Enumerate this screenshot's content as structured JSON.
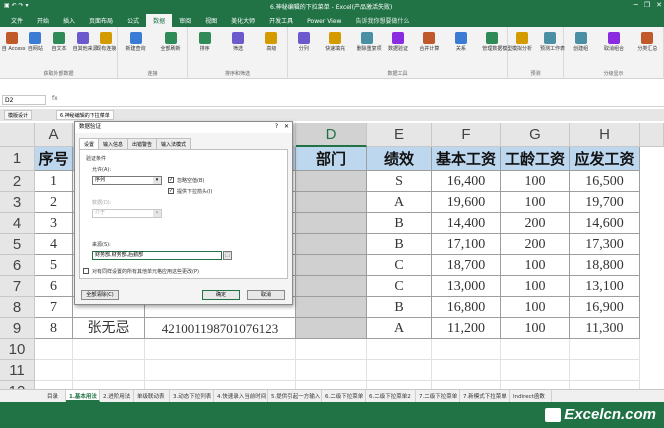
{
  "window": {
    "title": "6.神秘编辑的下拉菜单 - Excel(产品激活失败)",
    "quick_access": "▣ ↶ ↷ ▾"
  },
  "ribbon_tabs": [
    "文件",
    "开始",
    "插入",
    "页面布局",
    "公式",
    "数据",
    "审阅",
    "视图",
    "美化大师",
    "开发工具",
    "Power View"
  ],
  "active_tab_index": 5,
  "tell_me": "告诉我你想要做什么",
  "ribbon_groups": [
    {
      "label": "获取外部数据",
      "buttons": [
        "自 Access",
        "自网站",
        "自文本",
        "自其他来源",
        "现有连接"
      ]
    },
    {
      "label": "连接",
      "buttons": [
        "新建查询",
        "全部刷新"
      ]
    },
    {
      "label": "排序和筛选",
      "buttons": [
        "排序",
        "筛选",
        "高级"
      ]
    },
    {
      "label": "数据工具",
      "buttons": [
        "分列",
        "快速填充",
        "删除重复项",
        "数据验证",
        "合并计算",
        "关系",
        "管理数据模型"
      ]
    },
    {
      "label": "预测",
      "buttons": [
        "模拟分析",
        "预测工作表"
      ]
    },
    {
      "label": "分级显示",
      "buttons": [
        "创建组",
        "取消组合",
        "分类汇总"
      ]
    }
  ],
  "formula_bar": {
    "name_box": "D2",
    "fx": "fx"
  },
  "workbook_tabs": [
    "模版设计",
    "6.神秘编辑的下拉菜单"
  ],
  "columns": [
    "A",
    "B",
    "C",
    "D",
    "E",
    "F",
    "G",
    "H"
  ],
  "selected_column": "D",
  "rows": [
    "1",
    "2",
    "3",
    "4",
    "5",
    "6",
    "7",
    "8",
    "9",
    "10",
    "11",
    "12"
  ],
  "table": {
    "headers": {
      "A": "序号",
      "D": "部门",
      "E": "绩效",
      "F": "基本工资",
      "G": "工龄工资",
      "H": "应发工资"
    },
    "seq": [
      "1",
      "2",
      "3",
      "4",
      "5",
      "6",
      "7",
      "8"
    ],
    "name_row9": "张无忌",
    "id_row9": "421001198701076123",
    "perf": [
      "S",
      "A",
      "B",
      "B",
      "C",
      "C",
      "B",
      "A"
    ],
    "base": [
      "16,400",
      "19,600",
      "14,400",
      "17,100",
      "18,700",
      "13,000",
      "16,800",
      "11,200"
    ],
    "seniority": [
      "100",
      "100",
      "200",
      "200",
      "100",
      "100",
      "100",
      "100"
    ],
    "gross": [
      "16,500",
      "19,700",
      "14,600",
      "17,300",
      "18,800",
      "13,100",
      "16,900",
      "11,300"
    ]
  },
  "dialog": {
    "title": "数据验证",
    "help": "?",
    "close": "✕",
    "tabs": [
      "设置",
      "输入信息",
      "出错警告",
      "输入法模式"
    ],
    "active_tab": 0,
    "section": "验证条件",
    "allow_label": "允许(A):",
    "allow_value": "序列",
    "ignore_blank": "忽略空值(B)",
    "dropdown": "提供下拉箭头(I)",
    "data_label": "数据(D):",
    "data_value": "介于",
    "source_label": "来源(S):",
    "source_value": "财务部,财务部,后勤部",
    "apply_all": "对有同样设置的所有其他单元格应用这些更改(P)",
    "clear_all": "全部清除(C)",
    "ok": "确定",
    "cancel": "取消"
  },
  "sheet_tabs": [
    "目录",
    "1.基本用法",
    "2.进阶用法",
    "单级联动表",
    "3.动态下拉列表",
    "4.快速录入当前时间",
    "5.提供引起一方输入",
    "6.二级下拉菜单",
    "6.二级下拉菜单2",
    "7.二级下拉菜单",
    "7.新模式下拉菜单",
    "Indirect函数"
  ],
  "active_sheet_index": 1,
  "watermark": "Excelcn.com"
}
